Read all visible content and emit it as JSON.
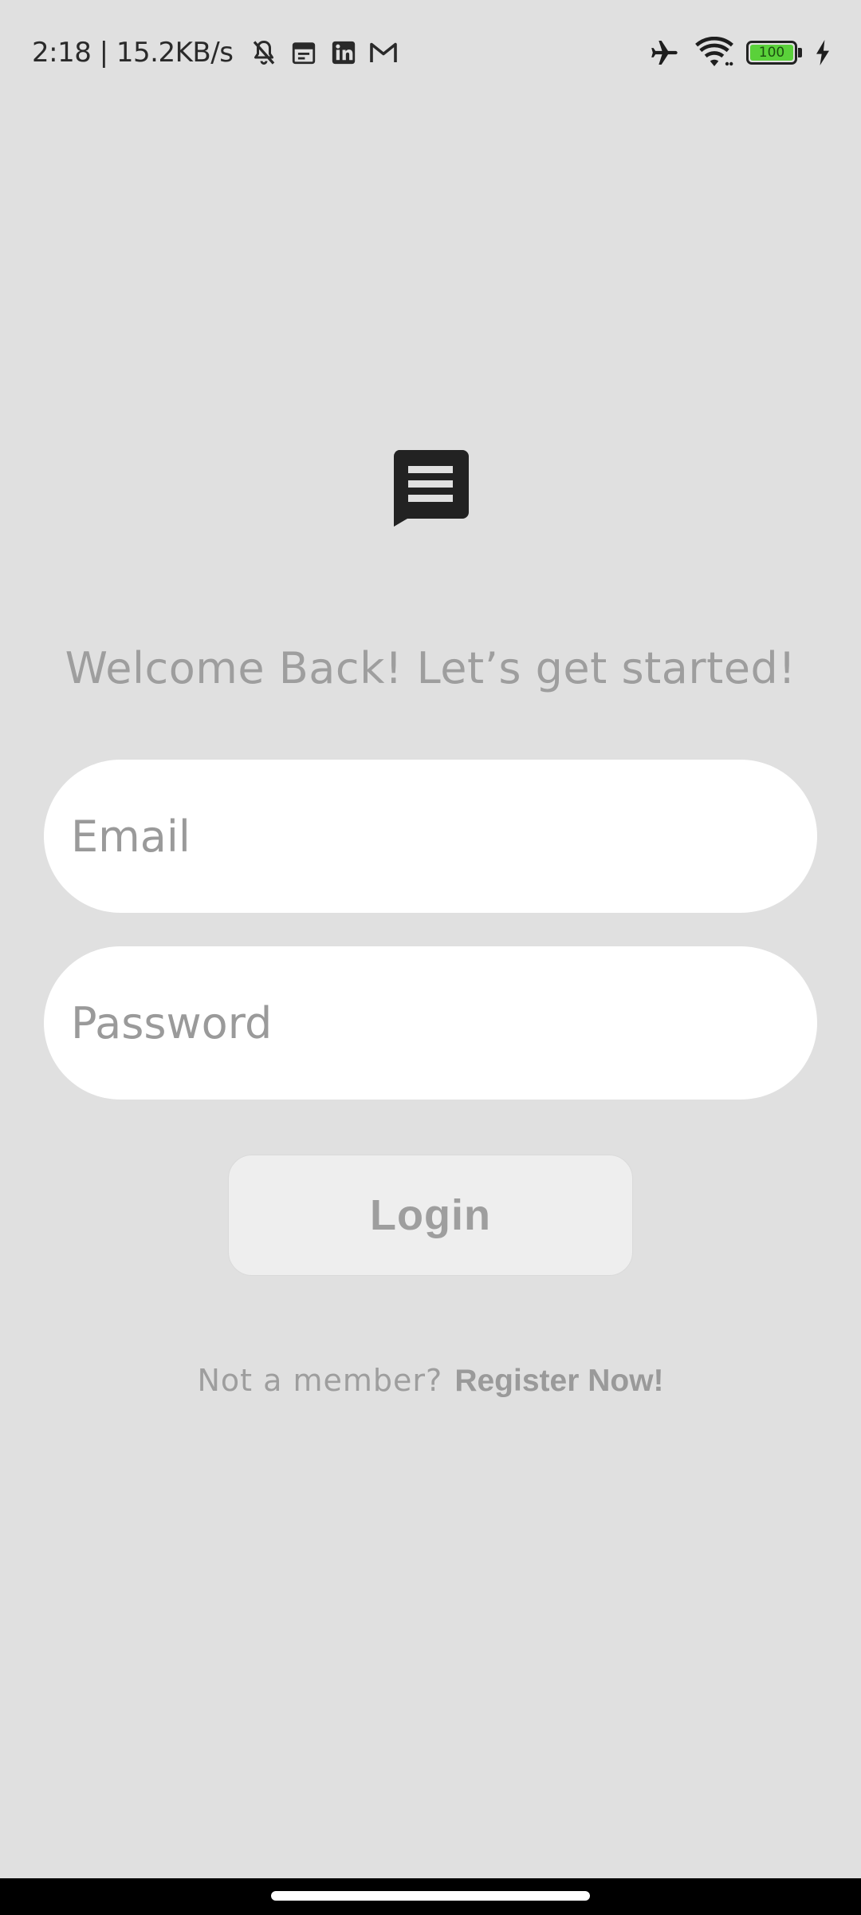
{
  "status_bar": {
    "time_speed": "2:18 | 15.2KB/s",
    "battery_level": "100",
    "left_icons": [
      "bell-off-icon",
      "calendar-icon",
      "linkedin-icon",
      "gmail-icon"
    ],
    "right_icons": [
      "airplane-icon",
      "wifi-icon",
      "battery-icon",
      "charging-icon"
    ],
    "battery_color": "#5ad13a"
  },
  "login": {
    "logo_icon": "chat-message-icon",
    "welcome": "Welcome Back! Let’s get started!",
    "email_placeholder": "Email",
    "password_placeholder": "Password",
    "login_label": "Login",
    "register_prompt": "Not a member?",
    "register_link": "Register Now!"
  },
  "colors": {
    "background": "#e0e0e0",
    "field_background": "#ffffff",
    "button_background": "#eeeeee",
    "muted_text": "#9e9e9e"
  }
}
